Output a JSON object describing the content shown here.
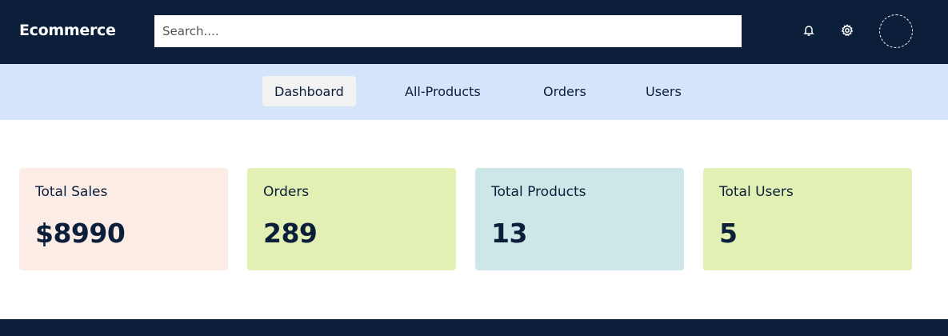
{
  "header": {
    "brand": "Ecommerce",
    "search": {
      "placeholder": "Search....",
      "value": ""
    },
    "icons": [
      "bell-icon",
      "gear-icon"
    ]
  },
  "nav": {
    "items": [
      {
        "label": "Dashboard",
        "active": true
      },
      {
        "label": "All-Products",
        "active": false
      },
      {
        "label": "Orders",
        "active": false
      },
      {
        "label": "Users",
        "active": false
      }
    ]
  },
  "stats": [
    {
      "label": "Total Sales",
      "value": "$8990",
      "color": "#fcece6"
    },
    {
      "label": "Orders",
      "value": "289",
      "color": "#e2f0b4"
    },
    {
      "label": "Total Products",
      "value": "13",
      "color": "#cde7e9"
    },
    {
      "label": "Total Users",
      "value": "5",
      "color": "#e2f0b4"
    }
  ],
  "colors": {
    "primary": "#0b1e3a",
    "nav_background": "#d6e4fb",
    "active_tab": "#f2f2f2"
  }
}
